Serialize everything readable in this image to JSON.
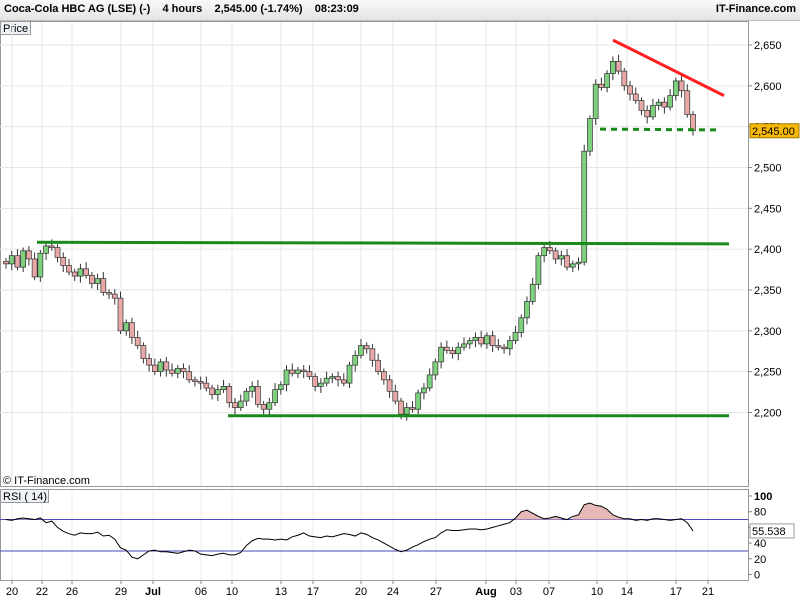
{
  "header": {
    "instrument": "Coca-Cola HBC AG (LSE) (-)",
    "timeframe": "4 hours",
    "price_change": "2,545.00 (-1.74%)",
    "time": "08:23:09",
    "brand": "IT-Finance.com"
  },
  "price_panel": {
    "label": "Price",
    "watermark": "© IT-Finance.com"
  },
  "rsi_panel": {
    "label": "RSI ( 14)"
  },
  "chart_data": [
    {
      "type": "candlestick",
      "title": "Price",
      "ylim": [
        2180,
        2680
      ],
      "yticks": [
        "2,650",
        "2,600",
        "2,550",
        "2,500",
        "2,450",
        "2,400",
        "2,350",
        "2,300",
        "2,250",
        "2,200"
      ],
      "ytick_values": [
        2650,
        2600,
        2550,
        2500,
        2450,
        2400,
        2350,
        2300,
        2250,
        2200
      ],
      "current_price_label": "2,545.00",
      "current_price": 2545,
      "xticks": [
        "20",
        "22",
        "26",
        "29",
        "Jul",
        "06",
        "10",
        "13",
        "17",
        "20",
        "24",
        "27",
        "Aug",
        "03",
        "07",
        "10",
        "14",
        "17",
        "21"
      ],
      "series": [
        {
          "name": "price",
          "points": [
            2382,
            2392,
            2378,
            2398,
            2388,
            2366,
            2395,
            2404,
            2402,
            2390,
            2380,
            2372,
            2367,
            2376,
            2368,
            2358,
            2364,
            2347,
            2345,
            2340,
            2300,
            2310,
            2292,
            2282,
            2266,
            2258,
            2250,
            2262,
            2252,
            2248,
            2254,
            2250,
            2240,
            2238,
            2236,
            2230,
            2222,
            2228,
            2232,
            2212,
            2206,
            2214,
            2226,
            2232,
            2210,
            2204,
            2212,
            2228,
            2234,
            2252,
            2248,
            2252,
            2250,
            2244,
            2232,
            2236,
            2242,
            2244,
            2240,
            2236,
            2258,
            2270,
            2282,
            2278,
            2264,
            2250,
            2240,
            2226,
            2214,
            2198,
            2206,
            2204,
            2224,
            2230,
            2246,
            2262,
            2280,
            2276,
            2272,
            2280,
            2284,
            2288,
            2292,
            2284,
            2294,
            2282,
            2280,
            2278,
            2288,
            2298,
            2316,
            2336,
            2357,
            2392,
            2402,
            2398,
            2388,
            2392,
            2378,
            2382,
            2384,
            2520,
            2560,
            2602,
            2598,
            2615,
            2630,
            2618,
            2600,
            2590,
            2582,
            2570,
            2562,
            2576,
            2580,
            2574,
            2588,
            2606,
            2594,
            2565,
            2545
          ]
        }
      ],
      "annotations": [
        {
          "type": "resistance",
          "color": "#1a8a1a",
          "y": 2408
        },
        {
          "type": "support",
          "color": "#1a8a1a",
          "y": 2196
        },
        {
          "type": "downtrend",
          "color": "#ff2020"
        },
        {
          "type": "dashed-level",
          "color": "#1a8a1a",
          "y": 2546
        }
      ],
      "grid": true
    },
    {
      "type": "line",
      "title": "RSI ( 14)",
      "ylim": [
        -5,
        105
      ],
      "yticks": [
        "100",
        "80",
        "60",
        "40",
        "20",
        "0"
      ],
      "ytick_values": [
        100,
        80,
        60,
        40,
        20,
        0
      ],
      "reference_lines": [
        70,
        30
      ],
      "current_value_label": "55.538",
      "series": [
        {
          "name": "RSI",
          "values": [
            70,
            69,
            71,
            72,
            71,
            70,
            72,
            66,
            68,
            60,
            55,
            52,
            50,
            53,
            52,
            52,
            54,
            49,
            50,
            45,
            34,
            31,
            22,
            20,
            25,
            30,
            31,
            29,
            29,
            28,
            27,
            29,
            31,
            30,
            26,
            25,
            24,
            26,
            27,
            25,
            25,
            28,
            37,
            43,
            46,
            45,
            45,
            44,
            45,
            44,
            48,
            50,
            53,
            49,
            48,
            47,
            49,
            48,
            50,
            52,
            51,
            49,
            53,
            51,
            47,
            44,
            40,
            36,
            32,
            29,
            31,
            35,
            38,
            42,
            45,
            47,
            53,
            57,
            56,
            56,
            57,
            58,
            58,
            57,
            58,
            60,
            62,
            64,
            66,
            72,
            80,
            82,
            78,
            74,
            71,
            72,
            74,
            72,
            70,
            74,
            76,
            89,
            91,
            88,
            87,
            83,
            76,
            73,
            71,
            71,
            69,
            70,
            69,
            71,
            71,
            70,
            69,
            70,
            71,
            66,
            55.5
          ]
        }
      ],
      "grid": true
    }
  ]
}
